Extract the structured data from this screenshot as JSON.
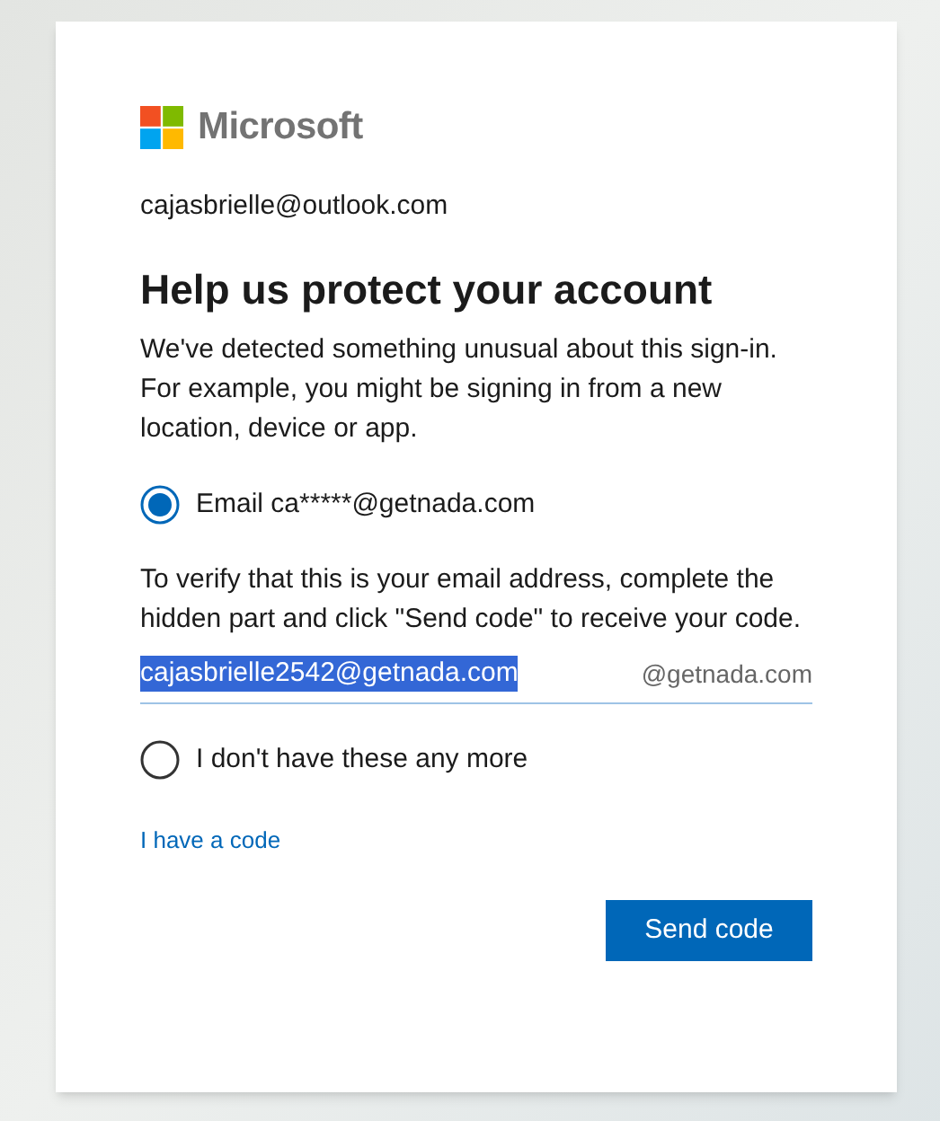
{
  "brand": {
    "name": "Microsoft"
  },
  "account": "cajasbrielle@outlook.com",
  "title": "Help us protect your account",
  "intro": "We've detected something unusual about this sign-in. For example, you might be signing in from a new location, device or app.",
  "options": [
    {
      "label": "Email ca*****@getnada.com",
      "selected": true
    },
    {
      "label": "I don't have these any more",
      "selected": false
    }
  ],
  "instructions": "To verify that this is your email address, complete the hidden part and click \"Send code\" to receive your code.",
  "email_field": {
    "value": "cajasbrielle2542@getnada.com",
    "text_selected": true,
    "suffix": "@getnada.com"
  },
  "link": "I have a code",
  "button": "Send code"
}
